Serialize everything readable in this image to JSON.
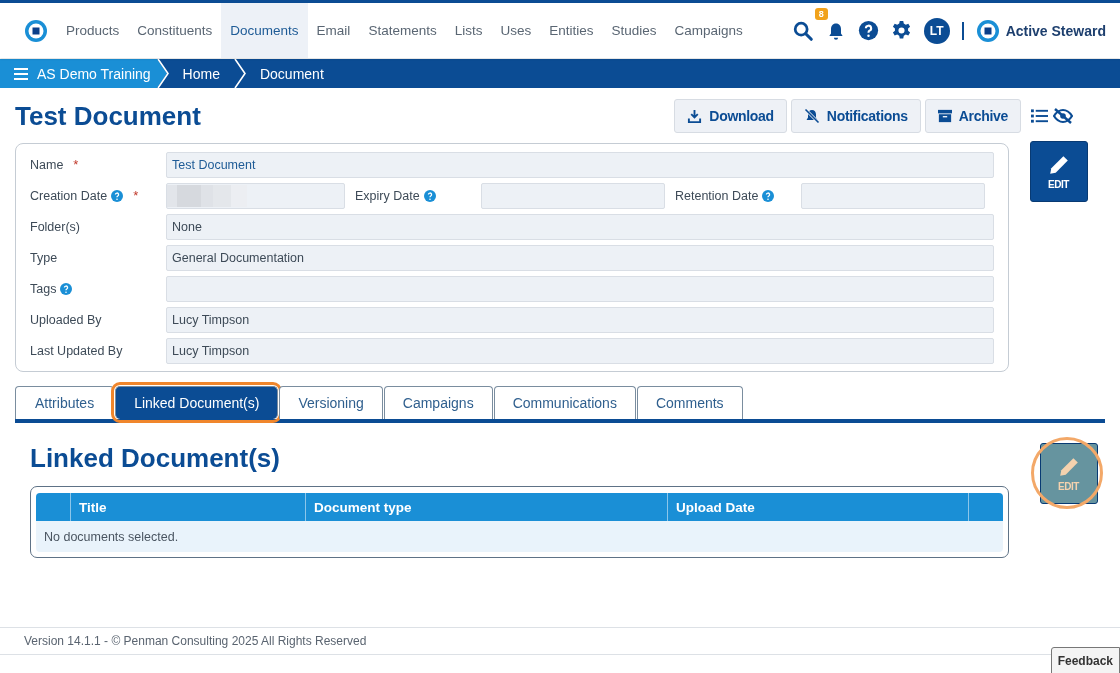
{
  "nav": {
    "items": [
      {
        "label": "Products",
        "selected": false
      },
      {
        "label": "Constituents",
        "selected": false
      },
      {
        "label": "Documents",
        "selected": true
      },
      {
        "label": "Email",
        "selected": false
      },
      {
        "label": "Statements",
        "selected": false
      },
      {
        "label": "Lists",
        "selected": false
      },
      {
        "label": "Uses",
        "selected": false
      },
      {
        "label": "Entities",
        "selected": false
      },
      {
        "label": "Studies",
        "selected": false
      },
      {
        "label": "Campaigns",
        "selected": false
      }
    ],
    "notification_count": "8",
    "avatar": "LT",
    "brand": "Active Steward"
  },
  "breadcrumb": [
    {
      "label": "AS Demo Training",
      "kind": "menu"
    },
    {
      "label": "Home",
      "kind": "crumb"
    },
    {
      "label": "Document",
      "kind": "crumb"
    }
  ],
  "page": {
    "title": "Test Document",
    "actions": [
      {
        "label": "Download",
        "kind": "download"
      },
      {
        "label": "Notifications",
        "kind": "mute"
      },
      {
        "label": "Archive",
        "kind": "archive"
      }
    ],
    "edit_button": {
      "label": "EDIT"
    }
  },
  "form": {
    "rows": [
      {
        "fields": [
          {
            "label": "Name",
            "required_mark": "*",
            "help": false,
            "value": "Test Document",
            "kind": "link"
          }
        ]
      },
      {
        "fields": [
          {
            "label": "Creation Date",
            "required_mark": "*",
            "help": true,
            "kind": "redacted"
          },
          {
            "label": "Expiry Date",
            "help": true,
            "kind": "text"
          },
          {
            "label": "Retention Date",
            "help": true,
            "kind": "text"
          }
        ]
      },
      {
        "fields": [
          {
            "label": "Folder(s)",
            "help": false,
            "value": "None",
            "kind": "text"
          }
        ]
      },
      {
        "fields": [
          {
            "label": "Type",
            "help": false,
            "value": "General Documentation",
            "kind": "text"
          }
        ]
      },
      {
        "fields": [
          {
            "label": "Tags",
            "help": true,
            "kind": "text"
          }
        ]
      },
      {
        "fields": [
          {
            "label": "Uploaded By",
            "help": false,
            "value": "Lucy Timpson",
            "kind": "text"
          }
        ]
      },
      {
        "fields": [
          {
            "label": "Last Updated By",
            "help": false,
            "value": "Lucy Timpson",
            "kind": "text"
          }
        ]
      }
    ]
  },
  "tabs": [
    {
      "label": "Attributes",
      "selected": false,
      "highlighted": false
    },
    {
      "label": "Linked Document(s)",
      "selected": true,
      "highlighted": true
    },
    {
      "label": "Versioning",
      "selected": false,
      "highlighted": false
    },
    {
      "label": "Campaigns",
      "selected": false,
      "highlighted": false
    },
    {
      "label": "Communications",
      "selected": false,
      "highlighted": false
    },
    {
      "label": "Comments",
      "selected": false,
      "highlighted": false
    }
  ],
  "linked": {
    "title": "Linked Document(s)",
    "columns": [
      "Title",
      "Document type",
      "Upload Date"
    ],
    "empty_text": "No documents selected.",
    "edit_button": {
      "label": "EDIT",
      "highlighted": true
    }
  },
  "footer": {
    "text": "Version 14.1.1 - © Penman Consulting 2025 All Rights Reserved",
    "feedback": "Feedback"
  }
}
